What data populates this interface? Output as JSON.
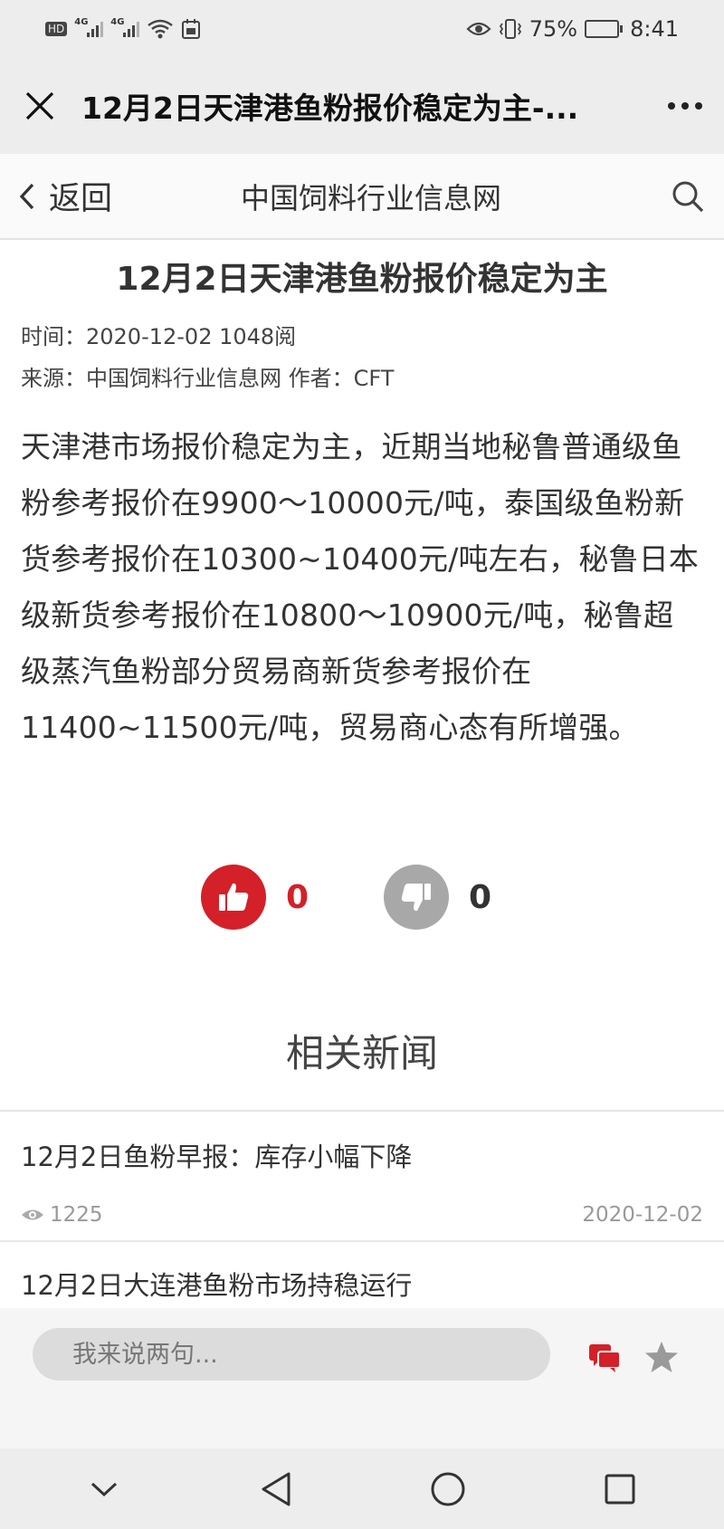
{
  "status_bar": {
    "hd": "HD",
    "network_1": "4G",
    "network_2": "4G",
    "battery_percent": "75%",
    "battery_level": 0.75,
    "time": "8:41"
  },
  "wechat_bar": {
    "title": "12月2日天津港鱼粉报价稳定为主-..."
  },
  "site_nav": {
    "back_label": "返回",
    "site_name": "中国饲料行业信息网"
  },
  "article": {
    "title": "12月2日天津港鱼粉报价稳定为主",
    "time_line": "时间：2020-12-02 1048阅",
    "source_line": "来源：中国饲料行业信息网 作者：CFT",
    "body": "天津港市场报价稳定为主，近期当地秘鲁普通级鱼粉参考报价在9900～10000元/吨，泰国级鱼粉新货参考报价在10300~10400元/吨左右，秘鲁日本级新货参考报价在10800～10900元/吨，秘鲁超级蒸汽鱼粉部分贸易商新货参考报价在11400~11500元/吨，贸易商心态有所增强。"
  },
  "votes": {
    "up_count": "0",
    "down_count": "0",
    "up_color": "#d42028",
    "down_color": "#a8a8a8"
  },
  "related": {
    "heading": "相关新闻",
    "items": [
      {
        "title": "12月2日鱼粉早报：库存小幅下降",
        "views": "1225",
        "date": "2020-12-02"
      },
      {
        "title": "12月2日大连港鱼粉市场持稳运行"
      }
    ]
  },
  "comment_bar": {
    "placeholder": "我来说两句..."
  }
}
